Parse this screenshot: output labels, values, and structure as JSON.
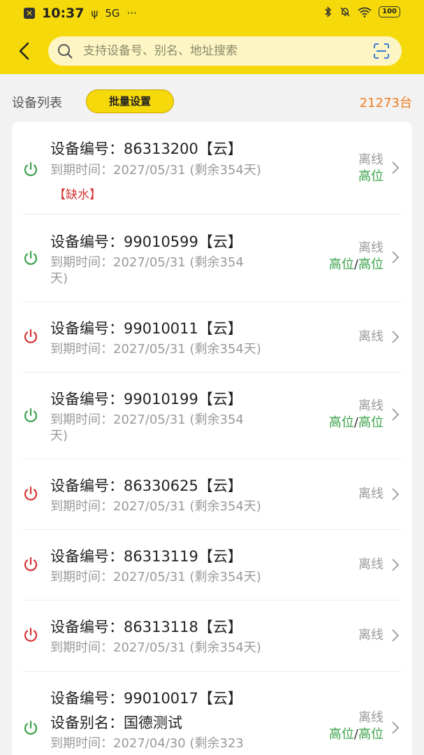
{
  "status_bar": {
    "time": "10:37",
    "usb": "ψ",
    "badge": "5G",
    "more": "···",
    "battery": "100"
  },
  "search": {
    "placeholder": "支持设备号、别名、地址搜索"
  },
  "list_header": {
    "title": "设备列表",
    "batch_button": "批量设置",
    "count": "21273台"
  },
  "colors": {
    "brand_yellow": "#f5d90a",
    "online_green": "#3aa24a",
    "offline_red": "#d63333",
    "count_orange": "#f07e1b"
  },
  "devices": [
    {
      "number_line": "设备编号：86313200【云】",
      "expiry_line1": "到期时间：2027/05/31 (剩余354天)",
      "expiry_line2": "",
      "warning": "【缺水】",
      "status": "离线",
      "level1": "高位",
      "level2": "",
      "power": "green"
    },
    {
      "number_line": "设备编号：99010599【云】",
      "expiry_line1": "到期时间：2027/05/31 (剩余354",
      "expiry_line2": "天)",
      "warning": "",
      "status": "离线",
      "level1": "高位",
      "level2": "高位",
      "power": "green"
    },
    {
      "number_line": "设备编号：99010011【云】",
      "expiry_line1": "到期时间：2027/05/31 (剩余354天)",
      "expiry_line2": "",
      "warning": "",
      "status": "离线",
      "level1": "",
      "level2": "",
      "power": "red"
    },
    {
      "number_line": "设备编号：99010199【云】",
      "expiry_line1": "到期时间：2027/05/31 (剩余354",
      "expiry_line2": "天)",
      "warning": "",
      "status": "离线",
      "level1": "高位",
      "level2": "高位",
      "power": "green"
    },
    {
      "number_line": "设备编号：86330625【云】",
      "expiry_line1": "到期时间：2027/05/31 (剩余354天)",
      "expiry_line2": "",
      "warning": "",
      "status": "离线",
      "level1": "",
      "level2": "",
      "power": "red"
    },
    {
      "number_line": "设备编号：86313119【云】",
      "expiry_line1": "到期时间：2027/05/31 (剩余354天)",
      "expiry_line2": "",
      "warning": "",
      "status": "离线",
      "level1": "",
      "level2": "",
      "power": "red"
    },
    {
      "number_line": "设备编号：86313118【云】",
      "expiry_line1": "到期时间：2027/05/31 (剩余354天)",
      "expiry_line2": "",
      "warning": "",
      "status": "离线",
      "level1": "",
      "level2": "",
      "power": "red"
    },
    {
      "number_line": "设备编号：99010017【云】",
      "alias_line": "设备别名：国德测试",
      "expiry_line1": "到期时间：2027/04/30 (剩余323",
      "expiry_line2": "",
      "warning": "",
      "status": "离线",
      "level1": "高位",
      "level2": "高位",
      "power": "green"
    }
  ]
}
